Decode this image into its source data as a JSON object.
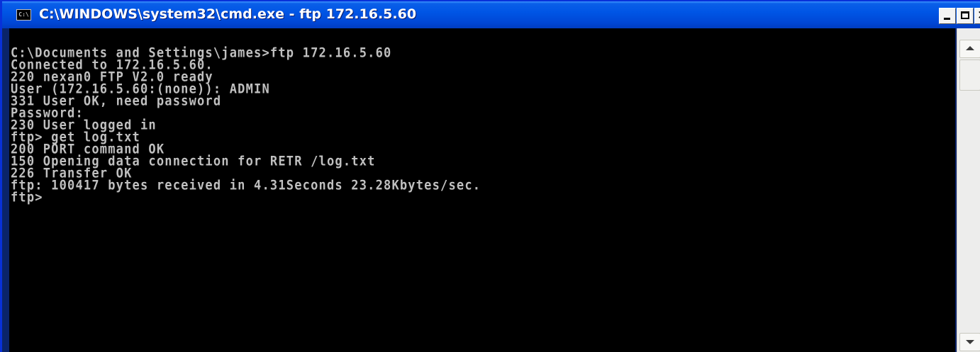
{
  "window": {
    "title": "C:\\WINDOWS\\system32\\cmd.exe - ftp 172.16.5.60",
    "icon_text": "C:\\",
    "icon_name": "cmd-window-icon",
    "buttons": {
      "minimize_icon": "minimize-icon",
      "maximize_icon": "maximize-icon",
      "close_icon": "close-icon",
      "close_glyph": "✕"
    }
  },
  "console": {
    "lines": [
      "C:\\Documents and Settings\\james>ftp 172.16.5.60",
      "Connected to 172.16.5.60.",
      "220 nexan0 FTP V2.0 ready",
      "User (172.16.5.60:(none)): ADMIN",
      "331 User OK, need password",
      "Password:",
      "230 User logged in",
      "ftp> get log.txt",
      "200 PORT command OK",
      "150 Opening data connection for RETR /log.txt",
      "226 Transfer OK",
      "ftp: 100417 bytes received in 4.31Seconds 23.28Kbytes/sec.",
      "ftp>"
    ],
    "text_color": "#c0c0c0",
    "background_color": "#000000"
  },
  "scrollbar": {
    "up_icon": "scroll-up-arrow-icon",
    "down_icon": "scroll-down-arrow-icon"
  }
}
